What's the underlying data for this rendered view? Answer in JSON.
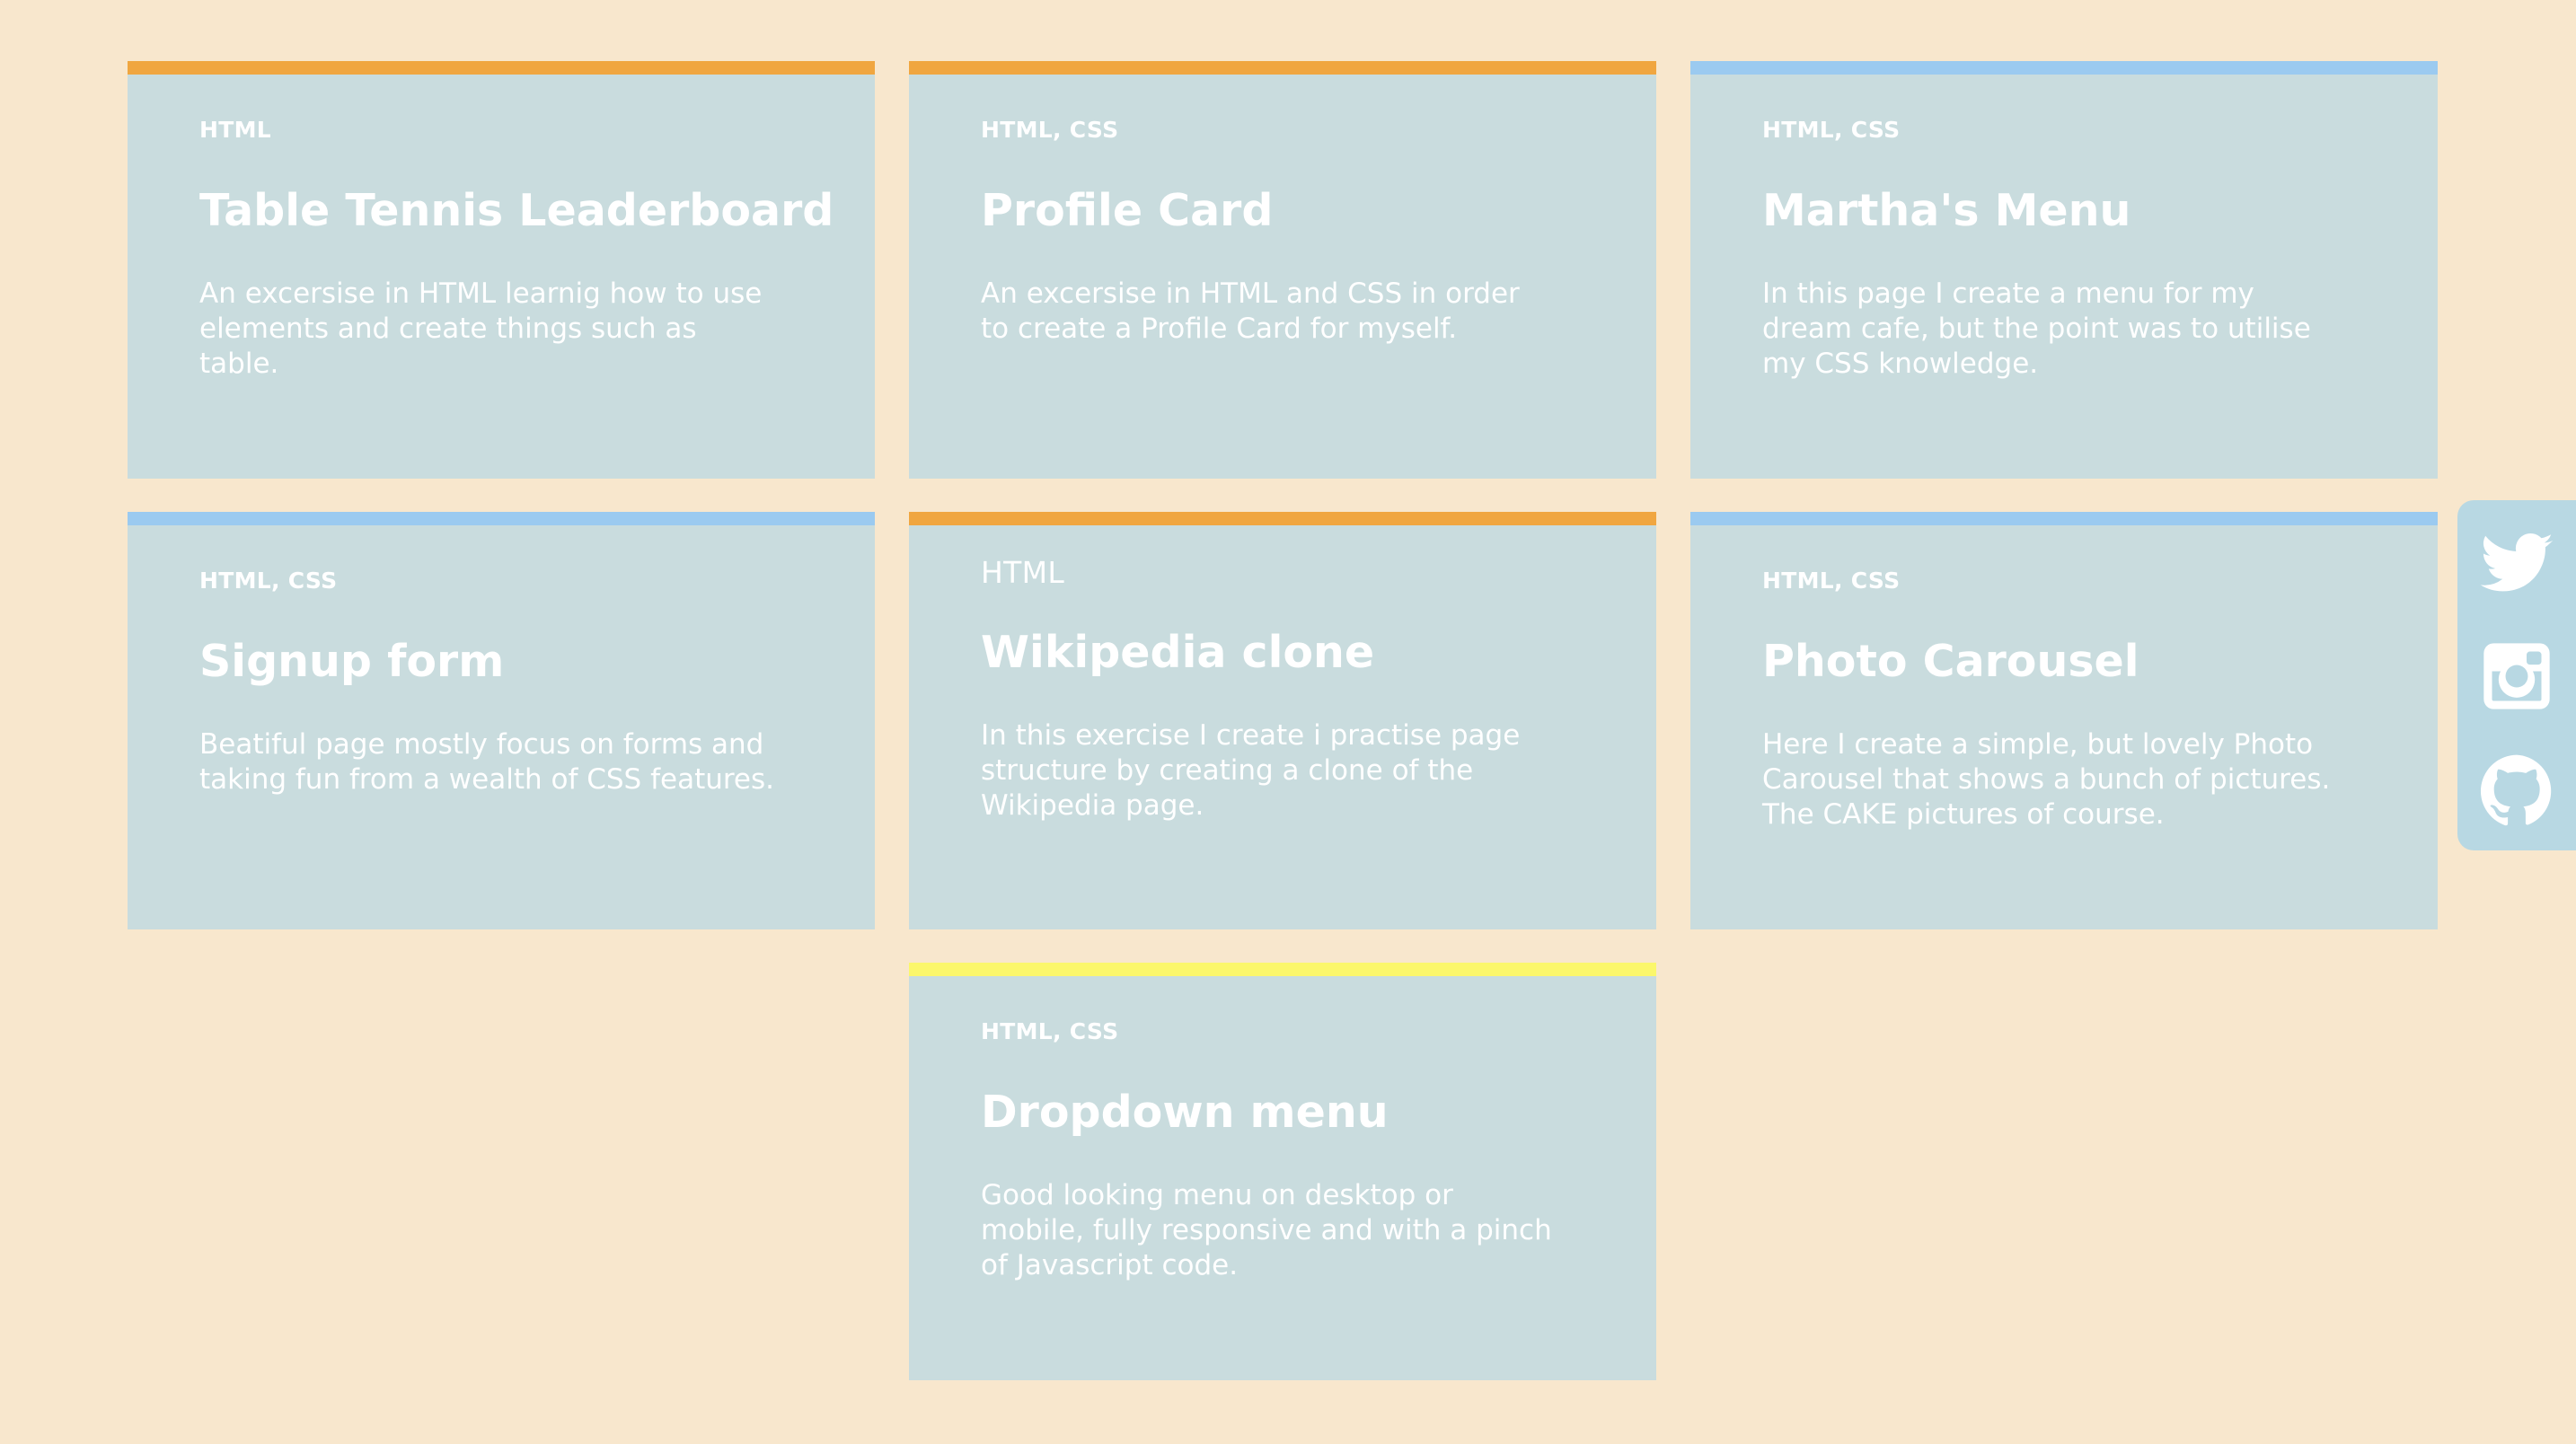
{
  "colors": {
    "background": "#f8e7cd",
    "card": "#c9dcde",
    "accent_orange": "#f0a640",
    "accent_blue": "#9bcaf0",
    "accent_yellow": "#fbf76b",
    "social_bar": "#b8d8e3"
  },
  "projects": [
    {
      "tags": "HTML",
      "title": "Table Tennis Leaderboard",
      "description": "An excersise in HTML learnig how to use elements and create things such as table.",
      "accent": "orange"
    },
    {
      "tags": "HTML, CSS",
      "title": "Profile Card",
      "description": "An excersise in HTML and CSS in order to create a Profile Card for myself.",
      "accent": "orange"
    },
    {
      "tags": "HTML, CSS",
      "title": "Martha's Menu",
      "description": "In this page I create a menu for my dream cafe, but the point was to utilise my CSS knowledge.",
      "accent": "blue"
    },
    {
      "tags": "HTML, CSS",
      "title": "Signup form",
      "description": "Beatiful page mostly focus on forms and taking fun from a wealth of CSS features.",
      "accent": "blue"
    },
    {
      "tags": "HTML",
      "title": "Wikipedia clone",
      "description": "In this exercise I create i practise page structure by creating a clone of the Wikipedia page.",
      "accent": "orange"
    },
    {
      "tags": "HTML, CSS",
      "title": "Photo Carousel",
      "description": "Here I create a simple, but lovely Photo Carousel that shows a bunch of pictures. The CAKE pictures of course.",
      "accent": "blue"
    },
    {
      "tags": "HTML, CSS",
      "title": "Dropdown menu",
      "description": "Good looking menu on desktop or mobile, fully responsive and with a pinch of Javascript code.",
      "accent": "yellow"
    }
  ],
  "social": [
    {
      "icon": "twitter-icon"
    },
    {
      "icon": "instagram-icon"
    },
    {
      "icon": "github-icon"
    }
  ]
}
